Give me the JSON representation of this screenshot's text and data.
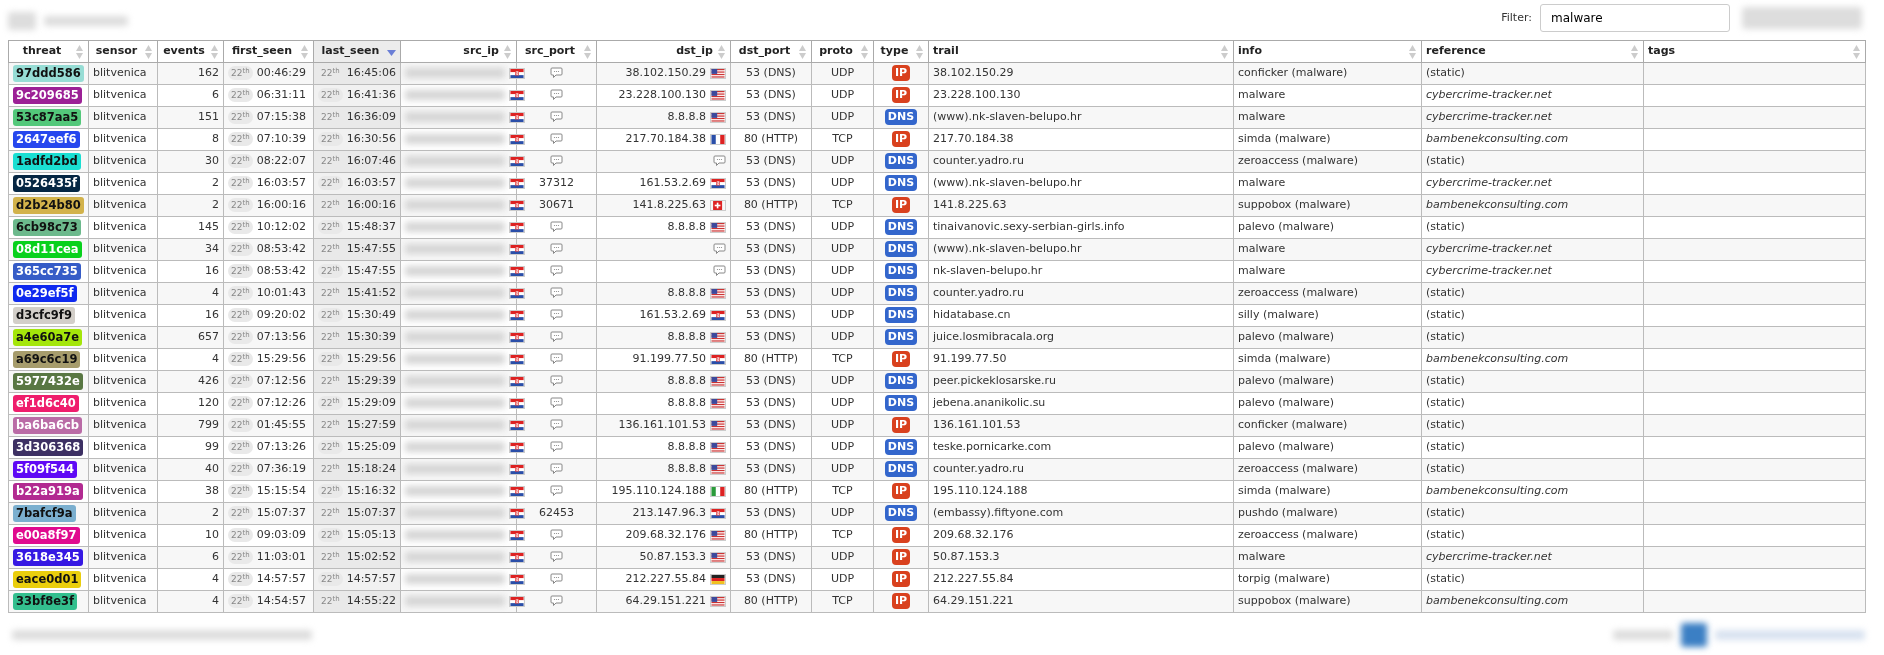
{
  "filter": {
    "label": "Filter:",
    "value": "malware"
  },
  "table": {
    "columns": [
      {
        "label": "threat",
        "sorted": false
      },
      {
        "label": "sensor",
        "sorted": false
      },
      {
        "label": "events",
        "sorted": false
      },
      {
        "label": "first_seen",
        "sorted": false
      },
      {
        "label": "last_seen",
        "sorted": true
      },
      {
        "label": "src_ip",
        "sorted": false
      },
      {
        "label": "src_port",
        "sorted": false
      },
      {
        "label": "dst_ip",
        "sorted": false
      },
      {
        "label": "dst_port",
        "sorted": false
      },
      {
        "label": "proto",
        "sorted": false
      },
      {
        "label": "type",
        "sorted": false
      },
      {
        "label": "trail",
        "sorted": false
      },
      {
        "label": "info",
        "sorted": false
      },
      {
        "label": "reference",
        "sorted": false
      },
      {
        "label": "tags",
        "sorted": false
      }
    ],
    "rows": [
      {
        "threat": "97ddd586",
        "color": "#97ddd5",
        "sensor": "blitvenica",
        "events": "162",
        "first_day": "22$^{th}$",
        "first_time": "00:46:29",
        "last_day": "22$^{th}$",
        "last_time": "16:45:06",
        "dst": {
          "ip": "38.102.150.29",
          "kind": "us"
        },
        "dst_port": "53 (DNS)",
        "proto": "UDP",
        "type": {
          "label": "IP",
          "color": "#d9411e"
        },
        "trail": "38.102.150.29",
        "info": "conficker (malware)",
        "reference": "(static)",
        "reference_italic": false
      },
      {
        "threat": "9c209685",
        "color": "#9c2096",
        "sensor": "blitvenica",
        "events": "6",
        "first_day": "22$^{th}$",
        "first_time": "06:31:11",
        "last_day": "22$^{th}$",
        "last_time": "16:41:36",
        "dst": {
          "ip": "23.228.100.130",
          "kind": "us"
        },
        "dst_port": "53 (DNS)",
        "proto": "UDP",
        "type": {
          "label": "IP",
          "color": "#d9411e"
        },
        "trail": "23.228.100.130",
        "info": "malware",
        "reference": "cybercrime-tracker.net",
        "reference_italic": true
      },
      {
        "threat": "53c87aa5",
        "color": "#53c87a",
        "sensor": "blitvenica",
        "events": "151",
        "first_day": "22$^{th}$",
        "first_time": "07:15:38",
        "last_day": "22$^{th}$",
        "last_time": "16:36:09",
        "dst": {
          "ip": "8.8.8.8",
          "kind": "us"
        },
        "dst_port": "53 (DNS)",
        "proto": "UDP",
        "type": {
          "label": "DNS",
          "color": "#3366cc"
        },
        "trail": "(www).nk-slaven-belupo.hr",
        "info": "malware",
        "reference": "cybercrime-tracker.net",
        "reference_italic": true
      },
      {
        "threat": "2647eef6",
        "color": "#2647ee",
        "sensor": "blitvenica",
        "events": "8",
        "first_day": "22$^{th}$",
        "first_time": "07:10:39",
        "last_day": "22$^{th}$",
        "last_time": "16:30:56",
        "dst": {
          "ip": "217.70.184.38",
          "kind": "fr"
        },
        "dst_port": "80 (HTTP)",
        "proto": "TCP",
        "type": {
          "label": "IP",
          "color": "#d9411e"
        },
        "trail": "217.70.184.38",
        "info": "simda (malware)",
        "reference": "bambenekconsulting.com",
        "reference_italic": true
      },
      {
        "threat": "1adfd2bd",
        "color": "#1adfd2",
        "sensor": "blitvenica",
        "events": "30",
        "first_day": "22$^{th}$",
        "first_time": "08:22:07",
        "last_day": "22$^{th}$",
        "last_time": "16:07:46",
        "dst_port": "53 (DNS)",
        "proto": "UDP",
        "type": {
          "label": "DNS",
          "color": "#3366cc"
        },
        "trail": "counter.yadro.ru",
        "info": "zeroaccess (malware)",
        "reference": "(static)",
        "reference_italic": false
      },
      {
        "threat": "0526435f",
        "color": "#052643",
        "sensor": "blitvenica",
        "events": "2",
        "first_day": "22$^{th}$",
        "first_time": "16:03:57",
        "last_day": "22$^{th}$",
        "last_time": "16:03:57",
        "src_port": "37312",
        "dst": {
          "ip": "161.53.2.69",
          "kind": "hr"
        },
        "dst_port": "53 (DNS)",
        "proto": "UDP",
        "type": {
          "label": "DNS",
          "color": "#3366cc"
        },
        "trail": "(www).nk-slaven-belupo.hr",
        "info": "malware",
        "reference": "cybercrime-tracker.net",
        "reference_italic": true
      },
      {
        "threat": "d2b24b80",
        "color": "#d2b24b",
        "sensor": "blitvenica",
        "events": "2",
        "first_day": "22$^{th}$",
        "first_time": "16:00:16",
        "last_day": "22$^{th}$",
        "last_time": "16:00:16",
        "src_port": "30671",
        "dst": {
          "ip": "141.8.225.63",
          "kind": "ch"
        },
        "dst_port": "80 (HTTP)",
        "proto": "TCP",
        "type": {
          "label": "IP",
          "color": "#d9411e"
        },
        "trail": "141.8.225.63",
        "info": "suppobox (malware)",
        "reference": "bambenekconsulting.com",
        "reference_italic": true
      },
      {
        "threat": "6cb98c73",
        "color": "#6cb98c",
        "sensor": "blitvenica",
        "events": "145",
        "first_day": "22$^{th}$",
        "first_time": "10:12:02",
        "last_day": "22$^{th}$",
        "last_time": "15:48:37",
        "dst": {
          "ip": "8.8.8.8",
          "kind": "us"
        },
        "dst_port": "53 (DNS)",
        "proto": "UDP",
        "type": {
          "label": "DNS",
          "color": "#3366cc"
        },
        "trail": "tinaivanovic.sexy-serbian-girls.info",
        "info": "palevo (malware)",
        "reference": "(static)",
        "reference_italic": false
      },
      {
        "threat": "08d11cea",
        "color": "#08d11c",
        "sensor": "blitvenica",
        "events": "34",
        "first_day": "22$^{th}$",
        "first_time": "08:53:42",
        "last_day": "22$^{th}$",
        "last_time": "15:47:55",
        "dst_port": "53 (DNS)",
        "proto": "UDP",
        "type": {
          "label": "DNS",
          "color": "#3366cc"
        },
        "trail": "(www).nk-slaven-belupo.hr",
        "info": "malware",
        "reference": "cybercrime-tracker.net",
        "reference_italic": true
      },
      {
        "threat": "365cc735",
        "color": "#365cc7",
        "sensor": "blitvenica",
        "events": "16",
        "first_day": "22$^{th}$",
        "first_time": "08:53:42",
        "last_day": "22$^{th}$",
        "last_time": "15:47:55",
        "dst_port": "53 (DNS)",
        "proto": "UDP",
        "type": {
          "label": "DNS",
          "color": "#3366cc"
        },
        "trail": "nk-slaven-belupo.hr",
        "info": "malware",
        "reference": "cybercrime-tracker.net",
        "reference_italic": true
      },
      {
        "threat": "0e29ef5f",
        "color": "#0e29ef",
        "sensor": "blitvenica",
        "events": "4",
        "first_day": "22$^{th}$",
        "first_time": "10:01:43",
        "last_day": "22$^{th}$",
        "last_time": "15:41:52",
        "dst": {
          "ip": "8.8.8.8",
          "kind": "us"
        },
        "dst_port": "53 (DNS)",
        "proto": "UDP",
        "type": {
          "label": "DNS",
          "color": "#3366cc"
        },
        "trail": "counter.yadro.ru",
        "info": "zeroaccess (malware)",
        "reference": "(static)",
        "reference_italic": false
      },
      {
        "threat": "d3cfc9f9",
        "color": "#d3cfc9",
        "sensor": "blitvenica",
        "events": "16",
        "first_day": "22$^{th}$",
        "first_time": "09:20:02",
        "last_day": "22$^{th}$",
        "last_time": "15:30:49",
        "dst": {
          "ip": "161.53.2.69",
          "kind": "hr"
        },
        "dst_port": "53 (DNS)",
        "proto": "UDP",
        "type": {
          "label": "DNS",
          "color": "#3366cc"
        },
        "trail": "hidatabase.cn",
        "info": "silly (malware)",
        "reference": "(static)",
        "reference_italic": false
      },
      {
        "threat": "a4e60a7e",
        "color": "#a4e60a",
        "sensor": "blitvenica",
        "events": "657",
        "first_day": "22$^{th}$",
        "first_time": "07:13:56",
        "last_day": "22$^{th}$",
        "last_time": "15:30:39",
        "dst": {
          "ip": "8.8.8.8",
          "kind": "us"
        },
        "dst_port": "53 (DNS)",
        "proto": "UDP",
        "type": {
          "label": "DNS",
          "color": "#3366cc"
        },
        "trail": "juice.losmibracala.org",
        "info": "palevo (malware)",
        "reference": "(static)",
        "reference_italic": false
      },
      {
        "threat": "a69c6c19",
        "color": "#a69c6c",
        "sensor": "blitvenica",
        "events": "4",
        "first_day": "22$^{th}$",
        "first_time": "15:29:56",
        "last_day": "22$^{th}$",
        "last_time": "15:29:56",
        "dst": {
          "ip": "91.199.77.50",
          "kind": "hr"
        },
        "dst_port": "80 (HTTP)",
        "proto": "TCP",
        "type": {
          "label": "IP",
          "color": "#d9411e"
        },
        "trail": "91.199.77.50",
        "info": "simda (malware)",
        "reference": "bambenekconsulting.com",
        "reference_italic": true
      },
      {
        "threat": "5977432e",
        "color": "#597743",
        "sensor": "blitvenica",
        "events": "426",
        "first_day": "22$^{th}$",
        "first_time": "07:12:56",
        "last_day": "22$^{th}$",
        "last_time": "15:29:39",
        "dst": {
          "ip": "8.8.8.8",
          "kind": "us"
        },
        "dst_port": "53 (DNS)",
        "proto": "UDP",
        "type": {
          "label": "DNS",
          "color": "#3366cc"
        },
        "trail": "peer.pickeklosarske.ru",
        "info": "palevo (malware)",
        "reference": "(static)",
        "reference_italic": false
      },
      {
        "threat": "ef1d6c40",
        "color": "#ef1d6c",
        "sensor": "blitvenica",
        "events": "120",
        "first_day": "22$^{th}$",
        "first_time": "07:12:26",
        "last_day": "22$^{th}$",
        "last_time": "15:29:09",
        "dst": {
          "ip": "8.8.8.8",
          "kind": "us"
        },
        "dst_port": "53 (DNS)",
        "proto": "UDP",
        "type": {
          "label": "DNS",
          "color": "#3366cc"
        },
        "trail": "jebena.ananikolic.su",
        "info": "palevo (malware)",
        "reference": "(static)",
        "reference_italic": false
      },
      {
        "threat": "ba6ba6cb",
        "color": "#ba6ba6",
        "sensor": "blitvenica",
        "events": "799",
        "first_day": "22$^{th}$",
        "first_time": "01:45:55",
        "last_day": "22$^{th}$",
        "last_time": "15:27:59",
        "dst": {
          "ip": "136.161.101.53",
          "kind": "us"
        },
        "dst_port": "53 (DNS)",
        "proto": "UDP",
        "type": {
          "label": "IP",
          "color": "#d9411e"
        },
        "trail": "136.161.101.53",
        "info": "conficker (malware)",
        "reference": "(static)",
        "reference_italic": false
      },
      {
        "threat": "3d306368",
        "color": "#3d3063",
        "sensor": "blitvenica",
        "events": "99",
        "first_day": "22$^{th}$",
        "first_time": "07:13:26",
        "last_day": "22$^{th}$",
        "last_time": "15:25:09",
        "dst": {
          "ip": "8.8.8.8",
          "kind": "us"
        },
        "dst_port": "53 (DNS)",
        "proto": "UDP",
        "type": {
          "label": "DNS",
          "color": "#3366cc"
        },
        "trail": "teske.pornicarke.com",
        "info": "palevo (malware)",
        "reference": "(static)",
        "reference_italic": false
      },
      {
        "threat": "5f09f544",
        "color": "#5f09f5",
        "sensor": "blitvenica",
        "events": "40",
        "first_day": "22$^{th}$",
        "first_time": "07:36:19",
        "last_day": "22$^{th}$",
        "last_time": "15:18:24",
        "dst": {
          "ip": "8.8.8.8",
          "kind": "us"
        },
        "dst_port": "53 (DNS)",
        "proto": "UDP",
        "type": {
          "label": "DNS",
          "color": "#3366cc"
        },
        "trail": "counter.yadro.ru",
        "info": "zeroaccess (malware)",
        "reference": "(static)",
        "reference_italic": false
      },
      {
        "threat": "b22a919a",
        "color": "#b22a91",
        "sensor": "blitvenica",
        "events": "38",
        "first_day": "22$^{th}$",
        "first_time": "15:15:54",
        "last_day": "22$^{th}$",
        "last_time": "15:16:32",
        "dst": {
          "ip": "195.110.124.188",
          "kind": "it"
        },
        "dst_port": "80 (HTTP)",
        "proto": "TCP",
        "type": {
          "label": "IP",
          "color": "#d9411e"
        },
        "trail": "195.110.124.188",
        "info": "simda (malware)",
        "reference": "bambenekconsulting.com",
        "reference_italic": true
      },
      {
        "threat": "7bafcf9a",
        "color": "#7bafcf",
        "sensor": "blitvenica",
        "events": "2",
        "first_day": "22$^{th}$",
        "first_time": "15:07:37",
        "last_day": "22$^{th}$",
        "last_time": "15:07:37",
        "src_port": "62453",
        "dst": {
          "ip": "213.147.96.3",
          "kind": "hr"
        },
        "dst_port": "53 (DNS)",
        "proto": "UDP",
        "type": {
          "label": "DNS",
          "color": "#3366cc"
        },
        "trail": "(embassy).fiftyone.com",
        "info": "pushdo (malware)",
        "reference": "(static)",
        "reference_italic": false
      },
      {
        "threat": "e00a8f97",
        "color": "#e00a8f",
        "sensor": "blitvenica",
        "events": "10",
        "first_day": "22$^{th}$",
        "first_time": "09:03:09",
        "last_day": "22$^{th}$",
        "last_time": "15:05:13",
        "dst": {
          "ip": "209.68.32.176",
          "kind": "us"
        },
        "dst_port": "80 (HTTP)",
        "proto": "TCP",
        "type": {
          "label": "IP",
          "color": "#d9411e"
        },
        "trail": "209.68.32.176",
        "info": "zeroaccess (malware)",
        "reference": "(static)",
        "reference_italic": false
      },
      {
        "threat": "3618e345",
        "color": "#3618e3",
        "sensor": "blitvenica",
        "events": "6",
        "first_day": "22$^{th}$",
        "first_time": "11:03:01",
        "last_day": "22$^{th}$",
        "last_time": "15:02:52",
        "dst": {
          "ip": "50.87.153.3",
          "kind": "us"
        },
        "dst_port": "53 (DNS)",
        "proto": "UDP",
        "type": {
          "label": "IP",
          "color": "#d9411e"
        },
        "trail": "50.87.153.3",
        "info": "malware",
        "reference": "cybercrime-tracker.net",
        "reference_italic": true
      },
      {
        "threat": "eace0d01",
        "color": "#eace0d",
        "sensor": "blitvenica",
        "events": "4",
        "first_day": "22$^{th}$",
        "first_time": "14:57:57",
        "last_day": "22$^{th}$",
        "last_time": "14:57:57",
        "dst": {
          "ip": "212.227.55.84",
          "kind": "de"
        },
        "dst_port": "53 (DNS)",
        "proto": "UDP",
        "type": {
          "label": "IP",
          "color": "#d9411e"
        },
        "trail": "212.227.55.84",
        "info": "torpig (malware)",
        "reference": "(static)",
        "reference_italic": false
      },
      {
        "threat": "33bf8e3f",
        "color": "#33bf8e",
        "sensor": "blitvenica",
        "events": "4",
        "first_day": "22$^{th}$",
        "first_time": "14:54:57",
        "last_day": "22$^{th}$",
        "last_time": "14:55:22",
        "dst": {
          "ip": "64.29.151.221",
          "kind": "us"
        },
        "dst_port": "80 (HTTP)",
        "proto": "TCP",
        "type": {
          "label": "IP",
          "color": "#d9411e"
        },
        "trail": "64.29.151.221",
        "info": "suppobox (malware)",
        "reference": "bambenekconsulting.com",
        "reference_italic": true
      }
    ]
  }
}
